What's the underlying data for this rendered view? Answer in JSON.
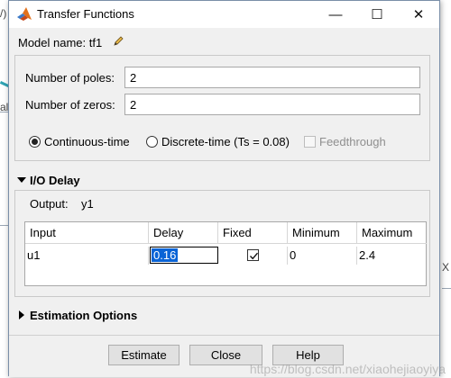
{
  "window": {
    "title": "Transfer Functions",
    "controls": {
      "minimize": "—",
      "maximize": "☐",
      "close": "✕"
    },
    "accent_color": "#0a64d6"
  },
  "background": {
    "fragment_top": "/)",
    "fragment_left": "al",
    "fragment_right": "X"
  },
  "model": {
    "name_label": "Model name: tf1"
  },
  "form": {
    "poles_label": "Number of poles:",
    "poles_value": "2",
    "zeros_label": "Number of zeros:",
    "zeros_value": "2",
    "time_domain": {
      "continuous_label": "Continuous-time",
      "discrete_label": "Discrete-time (Ts = 0.08)",
      "selected": "continuous"
    },
    "feedthrough_label": "Feedthrough"
  },
  "io_delay": {
    "heading": "I/O Delay",
    "output_label": "Output:",
    "output_value": "y1",
    "table": {
      "headers": [
        "Input",
        "Delay",
        "Fixed",
        "Minimum",
        "Maximum"
      ],
      "rows": [
        {
          "input": "u1",
          "delay": "0.16",
          "fixed": true,
          "minimum": "0",
          "maximum": "2.4"
        }
      ]
    }
  },
  "estimation": {
    "heading": "Estimation Options"
  },
  "buttons": {
    "estimate": "Estimate",
    "close": "Close",
    "help": "Help"
  },
  "watermark": "https://blog.csdn.net/xiaohejiaoyiya"
}
